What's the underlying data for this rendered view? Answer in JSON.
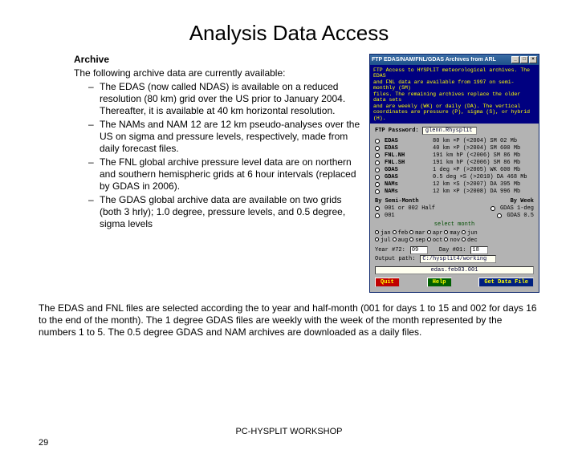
{
  "title": "Analysis Data Access",
  "archive": {
    "heading": "Archive",
    "intro": "The following archive data are currently available:",
    "bullets": [
      "The EDAS (now called NDAS) is available on a reduced resolution (80 km) grid over the US prior to January 2004. Thereafter, it is available at 40 km horizontal resolution.",
      "The NAMs and NAM 12 are 12 km pseudo-analyses over the US on sigma and pressure levels, respectively, made from daily forecast files.",
      "The FNL global archive pressure level data are on northern and southern hemispheric grids at 6 hour intervals (replaced by GDAS in 2006).",
      "The GDAS global archive data are available on two grids (both 3 hrly); 1.0 degree, pressure levels, and 0.5 degree, sigma levels"
    ]
  },
  "window": {
    "title": "FTP EDAS/NAM/FNL/GDAS Archives from ARL",
    "term_lines": "FTP Access to HYSPLIT meteorological archives. The EDAS\nand FNL data are available from 1997 on semi-monthly (SM)\nfiles. The remaining archives replace the older data sets\nand are weekly (WK) or daily (DA). The vertical\ncoordinates are pressure (P), sigma (S), or hybrid (H).",
    "password_label": "FTP Password:",
    "password_value": "glenn.Rhysplit",
    "datasets": [
      {
        "name": "EDAS",
        "desc": "80 km ×P (<2004) SM 02 Mb"
      },
      {
        "name": "EDAS",
        "desc": "40 km ×P (>2004) SM 600 Mb"
      },
      {
        "name": "FNL.NH",
        "desc": "191 km hP (<2006) SM 86 Mb"
      },
      {
        "name": "FNL.SH",
        "desc": "191 km hP (<2006) SM 86 Mb"
      },
      {
        "name": "GDAS",
        "desc": "1 deg ×P (>2005) WK 600 Mb"
      },
      {
        "name": "GDAS",
        "desc": "0.5 deg ×S (>2010) DA 468 Mb"
      },
      {
        "name": "NAMs",
        "desc": "12 km ×S (>2007) DA 395 Mb"
      },
      {
        "name": "NAMs",
        "desc": "12 km ×P (>2008) DA 996 Mb"
      }
    ],
    "sections": {
      "left": "By Semi-Month",
      "right": "By Week"
    },
    "leftopts": [
      "001 or 002 Half",
      "001"
    ],
    "rightopts": [
      "GDAS 1-deg",
      "GDAS 0.5"
    ],
    "select_label": "select month",
    "months": [
      [
        "jan",
        "feb",
        "mar",
        "apr",
        "may",
        "jun"
      ],
      [
        "jul",
        "aug",
        "sep",
        "oct",
        "nov",
        "dec"
      ]
    ],
    "year_label": "Year #72:",
    "year_val": "09",
    "day_label": "Day #01:",
    "day_val": "18",
    "out_label": "Output path:",
    "out_val": "C:/hysplit4/working",
    "filebar": "edas.feb03.001",
    "buttons": {
      "quit": "Quit",
      "help": "Help",
      "get": "Get Data File"
    }
  },
  "bottom": "The EDAS and FNL files are selected according the to year and half-month (001 for days 1 to 15 and 002 for days 16 to the end of the month).  The 1 degree GDAS files are weekly with the week of the month represented by the numbers 1 to 5.  The 0.5 degree GDAS and NAM archives are downloaded as a daily files.",
  "footer": "PC-HYSPLIT WORKSHOP",
  "page_no": "29"
}
